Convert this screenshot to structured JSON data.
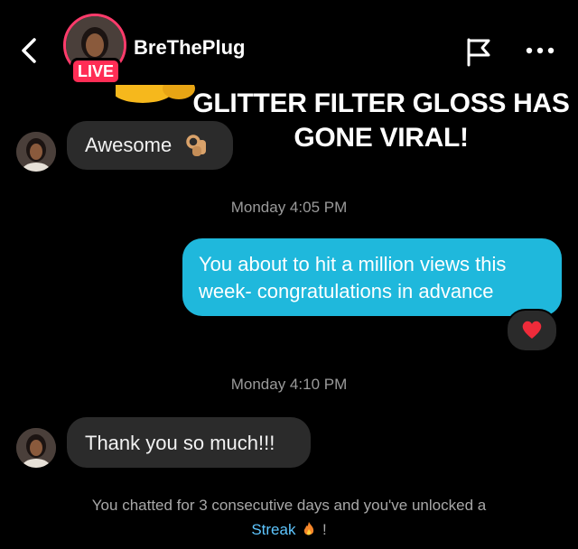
{
  "header": {
    "username": "BreThePlug",
    "live_label": "LIVE",
    "icons": [
      "back-arrow-icon",
      "flag-icon",
      "more-dots-icon"
    ]
  },
  "overlay_text": {
    "line1": "GLITTER FILTER GLOSS HAS",
    "line2": "GONE VIRAL!"
  },
  "messages": [
    {
      "sender": "them",
      "text": "Awesome",
      "emoji": "ok-hand"
    },
    {
      "timestamp": "Monday 4:05 PM"
    },
    {
      "sender": "me",
      "lines": [
        "You about to hit a million views this",
        "week- congratulations in advance"
      ],
      "reaction": "heart"
    },
    {
      "timestamp": "Monday 4:10 PM"
    },
    {
      "sender": "them",
      "text": "Thank you so much!!!"
    }
  ],
  "streak": {
    "line1": "You chatted for 3 consecutive days and you've unlocked a",
    "link": "Streak",
    "suffix": "!"
  },
  "colors": {
    "background": "#000000",
    "outgoing_bubble": "#1fb8dc",
    "incoming_bubble": "#2b2b2b",
    "live_badge": "#ff2d55",
    "streak_link": "#5ec6ff"
  }
}
